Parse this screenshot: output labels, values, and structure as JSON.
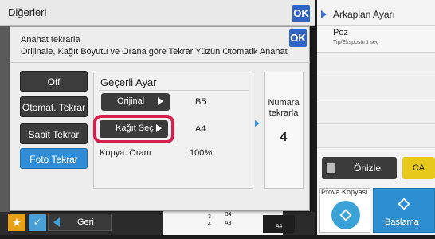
{
  "background": {
    "title": "Diğerleri",
    "ok_label": "OK",
    "right_panel": {
      "title": "Arkaplan Ayarı",
      "item": "Poz",
      "item_sub": "Tip/Eksposürü seç"
    },
    "preview_label": "Önizle",
    "ca_label": "CA",
    "proof_label": "Prova Kopyası",
    "start_label": "Başlama",
    "back_label": "Geri",
    "trays": [
      {
        "num": "3",
        "size": "B4"
      },
      {
        "num": "4",
        "size": "A3"
      }
    ],
    "tray_selected_size": "A4"
  },
  "modal": {
    "title": "Anahat tekrarla",
    "description": "Orijinale, Kağıt Boyutu ve Orana göre Tekrar Yüzün Otomatik Anahat",
    "ok_label": "OK",
    "modes": [
      {
        "label": "Off",
        "active": false
      },
      {
        "label": "Otomat. Tekrar",
        "active": false
      },
      {
        "label": "Sabit Tekrar",
        "active": false
      },
      {
        "label": "Foto Tekrar",
        "active": true
      }
    ],
    "current_settings": {
      "title": "Geçerli Ayar",
      "original_label": "Orijinal",
      "original_value": "B5",
      "paper_label": "Kağıt Seç",
      "paper_value": "A4",
      "ratio_label": "Kopya. Oranı",
      "ratio_value": "100%"
    },
    "repeat_count": {
      "label_line1": "Numara",
      "label_line2": "tekrarla",
      "value": "4"
    }
  },
  "colors": {
    "accent_blue": "#2f8cd6",
    "highlight_red": "#d6204b",
    "ca_yellow": "#e7c91c"
  }
}
